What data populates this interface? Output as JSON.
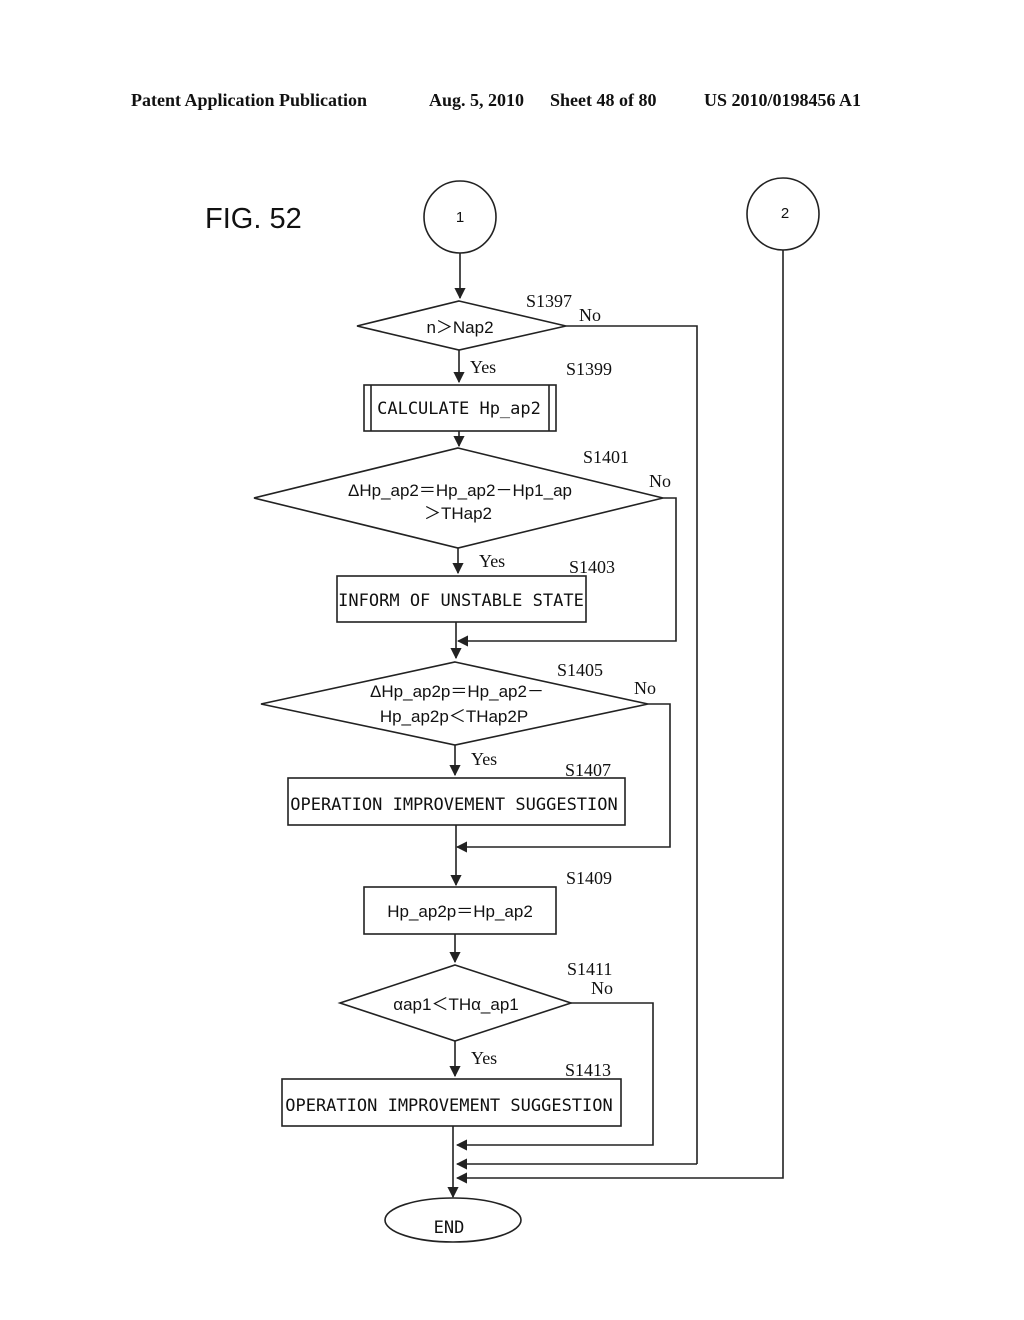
{
  "header": {
    "publication": "Patent Application Publication",
    "date": "Aug. 5, 2010",
    "sheet": "Sheet 48 of 80",
    "number": "US 2010/0198456 A1"
  },
  "figure": {
    "label": "FIG. 52"
  },
  "connectors": {
    "c1": "1",
    "c2": "2"
  },
  "labels": {
    "yes": "Yes",
    "no": "No"
  },
  "steps": {
    "s1397": {
      "id": "S1397",
      "type": "decision",
      "text": [
        "n＞Nap2"
      ]
    },
    "s1399": {
      "id": "S1399",
      "type": "subroutine",
      "text": [
        "CALCULATE Hp_ap2"
      ]
    },
    "s1401": {
      "id": "S1401",
      "type": "decision",
      "text": [
        "ΔHp_ap2＝Hp_ap2－Hp1_ap",
        "＞THap2"
      ]
    },
    "s1403": {
      "id": "S1403",
      "type": "process",
      "text": [
        "INFORM OF UNSTABLE STATE"
      ]
    },
    "s1405": {
      "id": "S1405",
      "type": "decision",
      "text": [
        "ΔHp_ap2p＝Hp_ap2－",
        "Hp_ap2p＜THap2P"
      ]
    },
    "s1407": {
      "id": "S1407",
      "type": "process",
      "text": [
        "OPERATION IMPROVEMENT SUGGESTION"
      ]
    },
    "s1409": {
      "id": "S1409",
      "type": "process",
      "text": [
        "Hp_ap2p＝Hp_ap2"
      ]
    },
    "s1411": {
      "id": "S1411",
      "type": "decision",
      "text": [
        "αap1＜THα_ap1"
      ]
    },
    "s1413": {
      "id": "S1413",
      "type": "process",
      "text": [
        "OPERATION IMPROVEMENT SUGGESTION"
      ]
    },
    "end": {
      "type": "terminator",
      "text": [
        "END"
      ]
    }
  }
}
